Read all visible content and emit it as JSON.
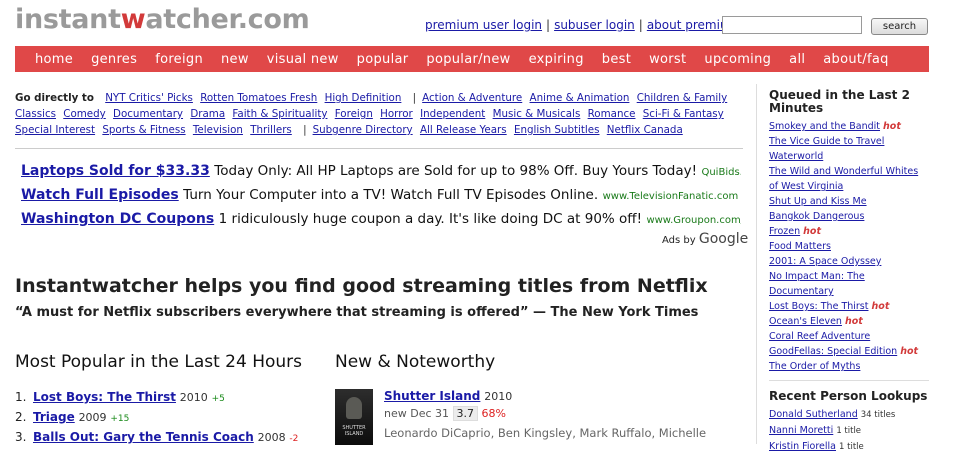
{
  "header": {
    "logo_pre": "instant",
    "logo_w": "w",
    "logo_post": "atcher.com",
    "links": [
      "premium user login",
      "subuser login",
      "about premium"
    ],
    "search_placeholder": "",
    "search_button": "search"
  },
  "nav": [
    "home",
    "genres",
    "foreign",
    "new",
    "visual new",
    "popular",
    "popular/new",
    "expiring",
    "best",
    "worst",
    "upcoming",
    "all",
    "about/faq"
  ],
  "go_directly": {
    "label": "Go directly to",
    "group1": [
      "NYT Critics' Picks",
      "Rotten Tomatoes Fresh",
      "High Definition"
    ],
    "group2": [
      "Action & Adventure",
      "Anime & Animation",
      "Children & Family",
      "Classics",
      "Comedy",
      "Documentary",
      "Drama",
      "Faith & Spirituality",
      "Foreign",
      "Horror",
      "Independent",
      "Music & Musicals",
      "Romance",
      "Sci-Fi & Fantasy",
      "Special Interest",
      "Sports & Fitness",
      "Television",
      "Thrillers"
    ],
    "group3": [
      "Subgenre Directory",
      "All Release Years",
      "English Subtitles",
      "Netflix Canada"
    ]
  },
  "ads": [
    {
      "title": "Laptops Sold for $33.33",
      "desc": "Today Only: All HP Laptops are Sold for up to 98% Off. Buy Yours Today!",
      "url": "QuiBids.com"
    },
    {
      "title": "Watch Full Episodes",
      "desc": "Turn Your Computer into a TV! Watch Full TV Episodes Online.",
      "url": "www.TelevisionFanatic.com"
    },
    {
      "title": "Washington DC Coupons",
      "desc": "1 ridiculously huge coupon a day. It's like doing DC at 90% off!",
      "url": "www.Groupon.com/Washington"
    }
  ],
  "ads_by": "Ads by",
  "ads_google": "Google",
  "headline": "Instantwatcher helps you find good streaming titles from Netflix",
  "quote": "“A must for Netflix subscribers everywhere that streaming is offered” — The New York Times",
  "most_popular": {
    "title": "Most Popular in the Last 24 Hours",
    "items": [
      {
        "num": "1.",
        "title": "Lost Boys: The Thirst",
        "year": "2010",
        "delta": "+5",
        "up": true
      },
      {
        "num": "2.",
        "title": "Triage",
        "year": "2009",
        "delta": "+15",
        "up": true
      },
      {
        "num": "3.",
        "title": "Balls Out: Gary the Tennis Coach",
        "year": "2008",
        "delta": "-2",
        "up": false
      }
    ]
  },
  "new_noteworthy": {
    "title": "New & Noteworthy",
    "item_title": "Shutter Island",
    "item_year": "2010",
    "meta_new": "new Dec 31",
    "rating": "3.7",
    "pct": "68%",
    "cast": [
      "Leonardo DiCaprio",
      "Ben Kingsley",
      "Mark Ruffalo",
      "Michelle"
    ],
    "thumb_caption": "SHUTTER ISLAND"
  },
  "sidebar": {
    "queued_title": "Queued in the Last 2 Minutes",
    "queued": [
      {
        "title": "Smokey and the Bandit",
        "hot": "hot"
      },
      {
        "title": "The Vice Guide to Travel",
        "hot": ""
      },
      {
        "title": "Waterworld",
        "hot": ""
      },
      {
        "title": "The Wild and Wonderful Whites of West Virginia",
        "hot": ""
      },
      {
        "title": "Shut Up and Kiss Me",
        "hot": ""
      },
      {
        "title": "Bangkok Dangerous",
        "hot": ""
      },
      {
        "title": "Frozen",
        "hot": "hot"
      },
      {
        "title": "Food Matters",
        "hot": ""
      },
      {
        "title": "2001: A Space Odyssey",
        "hot": ""
      },
      {
        "title": "No Impact Man: The Documentary",
        "hot": ""
      },
      {
        "title": "Lost Boys: The Thirst",
        "hot": "hot"
      },
      {
        "title": "Ocean's Eleven",
        "hot": "hot"
      },
      {
        "title": "Coral Reef Adventure",
        "hot": ""
      },
      {
        "title": "GoodFellas: Special Edition",
        "hot": "hot"
      },
      {
        "title": "The Order of Myths",
        "hot": ""
      }
    ],
    "persons_title": "Recent Person Lookups",
    "persons": [
      {
        "name": "Donald Sutherland",
        "count": "34 titles"
      },
      {
        "name": "Nanni Moretti",
        "count": "1 title"
      },
      {
        "name": "Kristin Fiorella",
        "count": "1 title"
      }
    ]
  },
  "colors": {
    "accent": "#e04848",
    "link": "#1a1aa6",
    "hot": "#d23a3a",
    "ad_url": "#1a7a1a"
  }
}
